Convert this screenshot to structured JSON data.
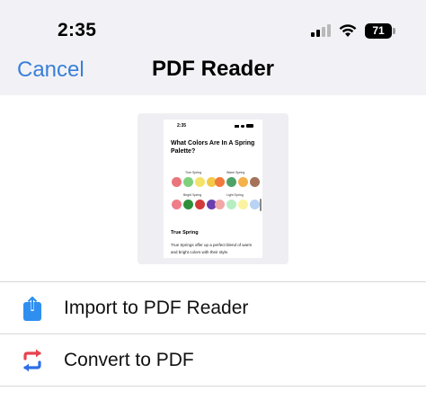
{
  "status_bar": {
    "time": "2:35",
    "battery_level": "71",
    "signal_bars_filled": 2,
    "signal_bars_total": 4
  },
  "nav": {
    "cancel_label": "Cancel",
    "title": "PDF Reader"
  },
  "preview": {
    "time": "2:35",
    "title": "What Colors Are In A Spring Palette?",
    "groups": [
      {
        "label": "True Spring",
        "colors": [
          "#e9757a",
          "#7fd07c",
          "#f4e36a",
          "#f3c94a"
        ]
      },
      {
        "label": "Warm Spring",
        "colors": [
          "#f07a3c",
          "#4ea267",
          "#f5b14a",
          "#a4735a"
        ]
      },
      {
        "label": "Bright Spring",
        "colors": [
          "#ef7d8a",
          "#2f8f3a",
          "#d33a3a",
          "#6a3fb0"
        ]
      },
      {
        "label": "Light Spring",
        "colors": [
          "#f2a7a7",
          "#b6eec3",
          "#fbf3a0",
          "#b8d3f3"
        ]
      }
    ],
    "subheading": "True Spring",
    "paragraph": "True Springs offer up a perfect blend of warm and bright colors with their style."
  },
  "actions": [
    {
      "label": "Import to PDF Reader",
      "icon": "share-upload-icon",
      "color": "#2f8ff0"
    },
    {
      "label": "Convert to PDF",
      "icon": "convert-arrows-icon",
      "colors": [
        "#e8424f",
        "#2f6ee8"
      ]
    }
  ],
  "colors": {
    "accent": "#3a7fd8",
    "header_bg": "#f2f2f6"
  }
}
